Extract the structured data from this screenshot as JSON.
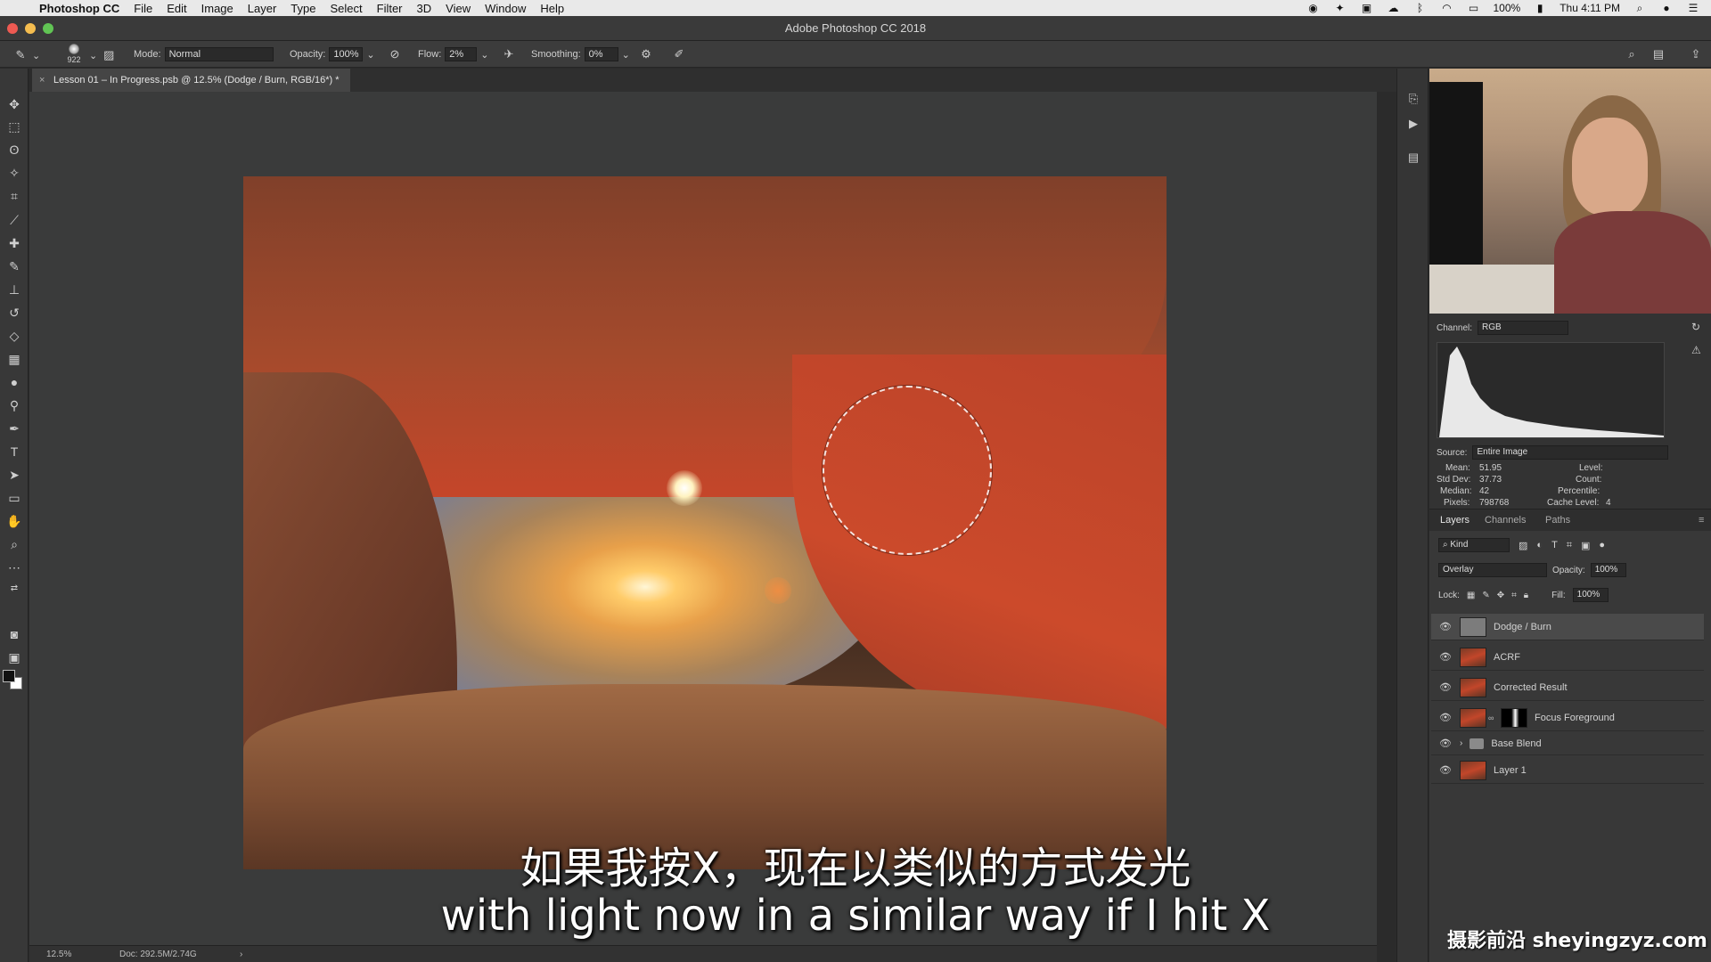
{
  "menubar": {
    "app_name": "Photoshop CC",
    "items": [
      "File",
      "Edit",
      "Image",
      "Layer",
      "Type",
      "Select",
      "Filter",
      "3D",
      "View",
      "Window",
      "Help"
    ],
    "battery": "100%",
    "clock": "Thu 4:11 PM"
  },
  "window": {
    "title": "Adobe Photoshop CC 2018"
  },
  "options": {
    "brush_size": "922",
    "mode_label": "Mode:",
    "mode_value": "Normal",
    "opacity_label": "Opacity:",
    "opacity_value": "100%",
    "flow_label": "Flow:",
    "flow_value": "2%",
    "smoothing_label": "Smoothing:",
    "smoothing_value": "0%"
  },
  "document": {
    "tab_title": "Lesson 01 – In Progress.psb @ 12.5% (Dodge / Burn, RGB/16*) *",
    "zoom": "12.5%",
    "doc_size": "Doc: 292.5M/2.74G"
  },
  "histogram": {
    "channel_label": "Channel:",
    "channel_value": "RGB",
    "source_label": "Source:",
    "source_value": "Entire Image",
    "mean_label": "Mean:",
    "mean_value": "51.95",
    "stddev_label": "Std Dev:",
    "stddev_value": "37.73",
    "median_label": "Median:",
    "median_value": "42",
    "pixels_label": "Pixels:",
    "pixels_value": "798768",
    "level_label": "Level:",
    "count_label": "Count:",
    "percentile_label": "Percentile:",
    "cache_label": "Cache Level:",
    "cache_value": "4"
  },
  "layers_panel": {
    "tabs": [
      "Layers",
      "Channels",
      "Paths"
    ],
    "kind_label": "Kind",
    "blend_mode": "Overlay",
    "opacity_label": "Opacity:",
    "opacity_value": "100%",
    "lock_label": "Lock:",
    "fill_label": "Fill:",
    "fill_value": "100%",
    "layers": [
      {
        "name": "Dodge / Burn"
      },
      {
        "name": "ACRF"
      },
      {
        "name": "Corrected Result"
      },
      {
        "name": "Focus Foreground"
      },
      {
        "name": "Base Blend"
      },
      {
        "name": "Layer 1"
      }
    ]
  },
  "subtitles": {
    "zh": "如果我按X，现在以类似的方式发光",
    "en": "with light now in a similar way if I hit X"
  },
  "watermark": "摄影前沿 sheyingzyz.com",
  "colors": {
    "accent": "#c5462a",
    "ui_dark": "#383838",
    "canvas_bg": "#3a3b3b"
  }
}
